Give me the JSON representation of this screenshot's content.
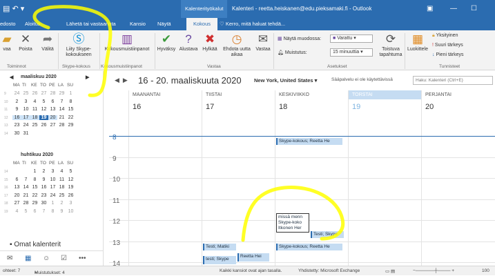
{
  "window": {
    "context_tab": "Kalenterityökalut",
    "title": "Kalenteri - reetta.heiskanen@edu.pieksamaki.fi - Outlook"
  },
  "tabs": [
    "edosto",
    "Aloitus",
    "Lähetä tai vastaanota",
    "Kansio",
    "Näytä",
    "Kokous"
  ],
  "tell_me": "Kerro, mitä haluat tehdä...",
  "ribbon": {
    "buttons": [
      {
        "label": "vaa",
        "icon": "folder-icon"
      },
      {
        "label": "Poista",
        "icon": "delete-icon"
      },
      {
        "label": "Välitä",
        "icon": "forward-icon"
      },
      {
        "label": "Liity Skype-kokoukseen",
        "icon": "skype-icon"
      },
      {
        "label": "Kokousmuistiinpanot",
        "icon": "onenote-icon"
      },
      {
        "label": "Hyväksy",
        "icon": "check-icon"
      },
      {
        "label": "Alustava",
        "icon": "question-icon"
      },
      {
        "label": "Hylkää",
        "icon": "decline-icon"
      },
      {
        "label": "Ehdota uutta aikaa",
        "icon": "propose-time-icon"
      },
      {
        "label": "Vastaa",
        "icon": "reply-icon"
      },
      {
        "label": "Toistuva tapahtuma",
        "icon": "recurrence-icon"
      },
      {
        "label": "Luokittele",
        "icon": "categorize-icon"
      }
    ],
    "groups": [
      "Toiminnot",
      "Skype-kokous",
      "Kokousmuistiinpanot",
      "Vastaa",
      "Asetukset",
      "Tunnisteet"
    ],
    "show_as_label": "Näytä muodossa:",
    "show_as_value": "Varattu",
    "reminder_label": "Muistutus:",
    "reminder_value": "15 minuuttia",
    "private": "Yksityinen",
    "high_importance": "Suuri tärkeys",
    "low_importance": "Pieni tärkeys"
  },
  "mini_calendars": [
    {
      "month": "maaliskuu 2020",
      "dow": [
        "MA",
        "TI",
        "KE",
        "TO",
        "PE",
        "LA",
        "SU"
      ],
      "weeks": [
        {
          "wk": "9",
          "days": [
            "24",
            "25",
            "26",
            "27",
            "28",
            "29",
            "1"
          ]
        },
        {
          "wk": "10",
          "days": [
            "2",
            "3",
            "4",
            "5",
            "6",
            "7",
            "8"
          ]
        },
        {
          "wk": "11",
          "days": [
            "9",
            "10",
            "11",
            "12",
            "13",
            "14",
            "15"
          ]
        },
        {
          "wk": "12",
          "days": [
            "16",
            "17",
            "18",
            "19",
            "20",
            "21",
            "22"
          ]
        },
        {
          "wk": "13",
          "days": [
            "23",
            "24",
            "25",
            "26",
            "27",
            "28",
            "29"
          ]
        },
        {
          "wk": "14",
          "days": [
            "30",
            "31"
          ]
        }
      ]
    },
    {
      "month": "huhtikuu 2020",
      "dow": [
        "MA",
        "TI",
        "KE",
        "TO",
        "PE",
        "LA",
        "SU"
      ],
      "weeks": [
        {
          "wk": "14",
          "days": [
            "",
            "",
            "1",
            "2",
            "3",
            "4",
            "5"
          ]
        },
        {
          "wk": "15",
          "days": [
            "6",
            "7",
            "8",
            "9",
            "10",
            "11",
            "12"
          ]
        },
        {
          "wk": "16",
          "days": [
            "13",
            "14",
            "15",
            "16",
            "17",
            "18",
            "19"
          ]
        },
        {
          "wk": "17",
          "days": [
            "20",
            "21",
            "22",
            "23",
            "24",
            "25",
            "26"
          ]
        },
        {
          "wk": "18",
          "days": [
            "27",
            "28",
            "29",
            "30",
            "1",
            "2",
            "3"
          ]
        },
        {
          "wk": "19",
          "days": [
            "4",
            "5",
            "6",
            "7",
            "8",
            "9",
            "10"
          ]
        }
      ]
    }
  ],
  "nav": {
    "my_calendars": "Omat kalenterit"
  },
  "calendar": {
    "title": "16 - 20. maaliskuuta 2020",
    "location": "New York, United States",
    "weather": "Sääpalvelu ei ole käytettävissä",
    "search_placeholder": "Haku: Kalenteri (Ctrl+E)",
    "days": [
      {
        "name": "MAANANTAI",
        "num": "16"
      },
      {
        "name": "TIISTAI",
        "num": "17"
      },
      {
        "name": "KESKIVIIKKO",
        "num": "18"
      },
      {
        "name": "TORSTAI",
        "num": "19"
      },
      {
        "name": "PERJANTAI",
        "num": "20"
      }
    ],
    "hours": [
      "8",
      "9",
      "10",
      "11",
      "12",
      "13",
      "14"
    ],
    "events": [
      {
        "label": "Skype-kokous; Reetta He"
      },
      {
        "label": "missä menn Skype-koko Itkonen Her"
      },
      {
        "label": "Testi; Skype"
      },
      {
        "label": "Testi; Matiki"
      },
      {
        "label": "Skype-kokous; Reetta He"
      },
      {
        "label": "testi; Skype"
      },
      {
        "label": "Reetta Hei"
      }
    ]
  },
  "status": {
    "items": "ohteet: 7",
    "reminders": "Muistutukset: 4",
    "folders": "Kaikki kansiot ovat ajan tasalla.",
    "connection": "Yhdistetty: Microsoft Exchange",
    "zoom": "100"
  },
  "colors": {
    "accent": "#2b6cb0",
    "highlight": "#ffff00",
    "event": "#c5dcf2"
  }
}
